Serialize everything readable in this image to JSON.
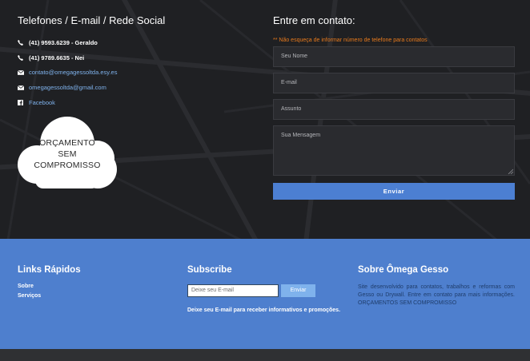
{
  "contact_info": {
    "heading": "Telefones / E-mail / Rede Social",
    "items": [
      {
        "icon": "phone-icon",
        "text": "(41) 9593.6239 - Geraldo",
        "style": "white"
      },
      {
        "icon": "phone-icon",
        "text": "(41) 9789.6635 - Nei",
        "style": "white"
      },
      {
        "icon": "email-icon",
        "text": "contato@omegagessoltda.esy.es",
        "style": "link"
      },
      {
        "icon": "email-icon",
        "text": "omegagessoltda@gmail.com",
        "style": "link"
      },
      {
        "icon": "facebook-icon",
        "text": "Facebook",
        "style": "link"
      }
    ],
    "badge_lines": [
      "ORÇAMENTO",
      "SEM",
      "COMPROMISSO"
    ]
  },
  "contact_form": {
    "heading": "Entre em contato:",
    "warning": "** Não esqueça de informar número de telefone para contatos",
    "name_placeholder": "Seu Nome",
    "email_placeholder": "E-mail",
    "subject_placeholder": "Assunto",
    "message_placeholder": "Sua Mensagem",
    "submit_label": "Enviar"
  },
  "footer": {
    "links_heading": "Links Rápidos",
    "links": [
      "Sobre",
      "Serviços"
    ],
    "subscribe_heading": "Subscribe",
    "subscribe_placeholder": "Deixe seu E-mail",
    "subscribe_button": "Enviar",
    "subscribe_note": "Deixe seu E-mail para receber informativos e promoções.",
    "about_heading": "Sobre Ômega Gesso",
    "about_text": "Site desenvolvido para contatos, trabalhos e reformas com Gesso ou Drywall. Entre em contato para mais informações. ORÇAMENTOS SEM COMPROMISSO"
  },
  "colors": {
    "footer_bg": "#4e7fce",
    "button_blue": "#4c7fd2",
    "warning_orange": "#e87a1c",
    "link_blue": "#7fb2ec"
  }
}
